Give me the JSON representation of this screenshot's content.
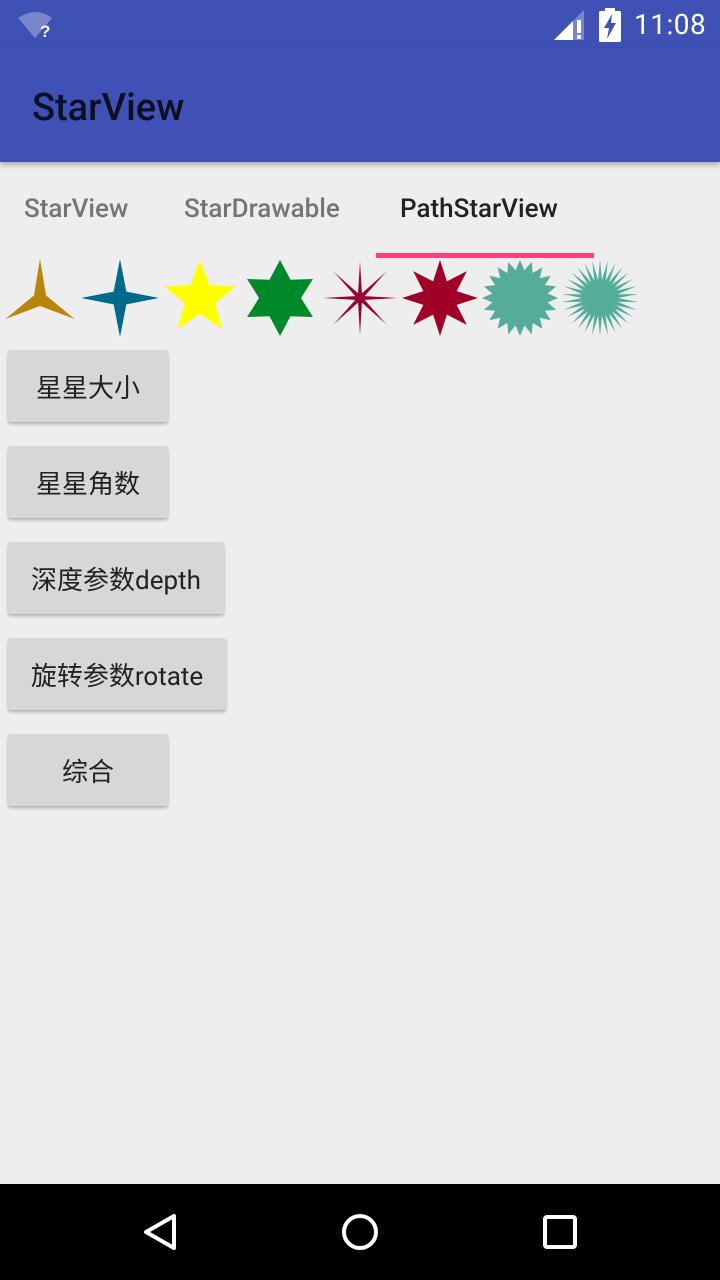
{
  "status_bar": {
    "time": "11:08",
    "icons": [
      "wifi-unknown-icon",
      "signal-no-data-icon",
      "battery-charging-icon"
    ],
    "background": "#3f51b5"
  },
  "app_bar": {
    "title": "StarView",
    "background": "#3f51b5"
  },
  "tabs": {
    "items": [
      {
        "label": "StarView",
        "active": false
      },
      {
        "label": "StarDrawable",
        "active": false
      },
      {
        "label": "PathStarView",
        "active": true
      }
    ],
    "indicator_color": "#ff4081"
  },
  "stars": [
    {
      "name": "3-point-star",
      "points": 3,
      "color": "#b8860b"
    },
    {
      "name": "4-point-star",
      "points": 4,
      "color": "#006a8a"
    },
    {
      "name": "5-point-star",
      "points": 5,
      "color": "#ffff00"
    },
    {
      "name": "6-point-star",
      "points": 6,
      "color": "#00892a"
    },
    {
      "name": "8-point-thin-star",
      "points": 8,
      "color": "#990033"
    },
    {
      "name": "8-point-star",
      "points": 8,
      "color": "#a00028"
    },
    {
      "name": "20-point-burst",
      "points": 20,
      "color": "#55ac9a"
    },
    {
      "name": "30-point-burst",
      "points": 30,
      "color": "#55ac9a"
    }
  ],
  "buttons": {
    "star_size": "星星大小",
    "star_corners": "星星角数",
    "depth": "深度参数depth",
    "rotate": "旋转参数rotate",
    "combined": "综合"
  },
  "nav_bar": {
    "icons": [
      "back-icon",
      "home-icon",
      "recents-icon"
    ]
  }
}
